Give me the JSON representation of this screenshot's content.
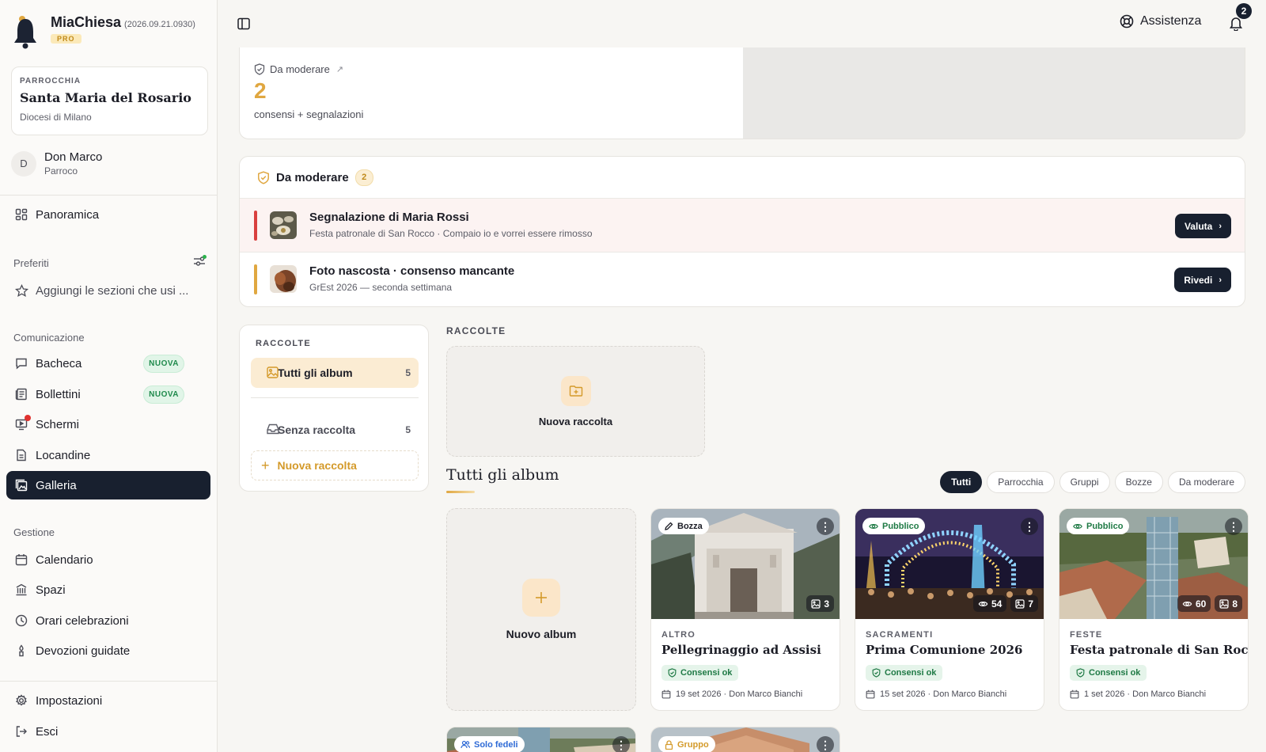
{
  "brand": {
    "name": "MiaChiesa",
    "version": "(2026.09.21.0930)",
    "badge": "PRO"
  },
  "parish": {
    "kicker": "PARROCCHIA",
    "name": "Santa Maria del Rosario",
    "diocese": "Diocesi di Milano"
  },
  "user": {
    "initial": "D",
    "name": "Don Marco",
    "role": "Parroco"
  },
  "nav": {
    "overview": "Panoramica",
    "favorites_title": "Preferiti",
    "favorites_placeholder": "Aggiungi le sezioni che usi ...",
    "communication_title": "Comunicazione",
    "communication": [
      {
        "label": "Bacheca",
        "badge": "NUOVA"
      },
      {
        "label": "Bollettini",
        "badge": "NUOVA"
      },
      {
        "label": "Schermi"
      },
      {
        "label": "Locandine"
      },
      {
        "label": "Galleria"
      }
    ],
    "management_title": "Gestione",
    "management": [
      {
        "label": "Calendario"
      },
      {
        "label": "Spazi"
      },
      {
        "label": "Orari celebrazioni"
      },
      {
        "label": "Devozioni guidate"
      }
    ],
    "settings": "Impostazioni",
    "logout": "Esci"
  },
  "topbar": {
    "help": "Assistenza",
    "notifications": "2"
  },
  "stat": {
    "label": "Da moderare",
    "value": "2",
    "sub": "consensi + segnalazioni"
  },
  "moderation": {
    "title": "Da moderare",
    "count": "2",
    "items": [
      {
        "title": "Segnalazione di Maria Rossi",
        "sub": "Festa patronale di San Rocco · Compaio io e vorrei essere rimosso",
        "action": "Valuta",
        "accent": "#d9403f"
      },
      {
        "title": "Foto nascosta · consenso mancante",
        "sub": "GrEst 2026 — seconda settimana",
        "action": "Rivedi",
        "accent": "#e0a740"
      }
    ]
  },
  "collections": {
    "kicker": "RACCOLTE",
    "all": {
      "label": "Tutti gli album",
      "count": "5"
    },
    "none": {
      "label": "Senza raccolta",
      "count": "5"
    },
    "new": "Nuova raccolta"
  },
  "main": {
    "kicker": "RACCOLTE",
    "new_collection": "Nuova raccolta",
    "albums_title": "Tutti gli album",
    "filters": [
      "Tutti",
      "Parrocchia",
      "Gruppi",
      "Bozze",
      "Da moderare"
    ],
    "new_album": "Nuovo album"
  },
  "albums": [
    {
      "status": "Bozza",
      "status_color": "#1c1d26",
      "photos": "3",
      "category": "ALTRO",
      "name": "Pellegrinaggio ad Assisi",
      "consent": "Consensi ok",
      "meta": "19 set 2026 · Don Marco Bianchi"
    },
    {
      "status": "Pubblico",
      "status_color": "#1f7a45",
      "views": "54",
      "photos": "7",
      "category": "SACRAMENTI",
      "name": "Prima Comunione 2026",
      "consent": "Consensi ok",
      "meta": "15 set 2026 · Don Marco Bianchi"
    },
    {
      "status": "Pubblico",
      "status_color": "#1f7a45",
      "views": "60",
      "photos": "8",
      "category": "FESTE",
      "name": "Festa patronale di San Rocco",
      "consent": "Consensi ok",
      "meta": "1 set 2026 · Don Marco Bianchi"
    },
    {
      "status": "Solo fedeli",
      "status_color": "#2f6bd6"
    },
    {
      "status": "Gruppo",
      "status_color": "#d49a2a"
    }
  ]
}
